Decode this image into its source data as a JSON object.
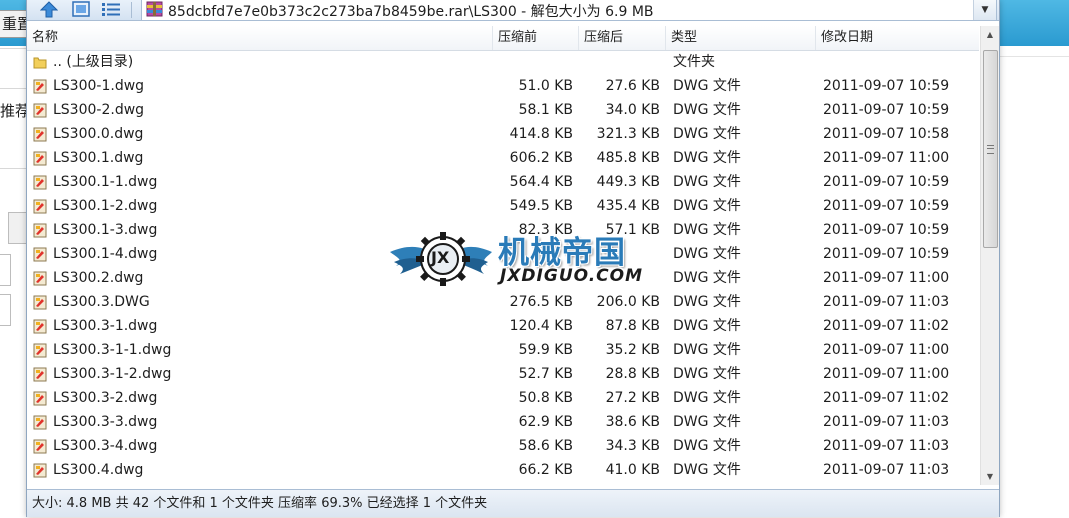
{
  "background_page": {
    "reset_button_label": "重置",
    "recommend_label": "推荐"
  },
  "toolbar": {
    "icons": [
      "up-arrow-icon",
      "view-mode-icon",
      "list-view-icon",
      "rar-archive-icon"
    ],
    "address_path": "85dcbfd7e7e0b373c2c273ba7b8459be.rar\\LS300 - 解包大小为 6.9 MB"
  },
  "columns": {
    "name": "名称",
    "packed": "压缩前",
    "size": "压缩后",
    "type": "类型",
    "modified": "修改日期"
  },
  "files": [
    {
      "name": ".. (上级目录)",
      "packed": "",
      "size": "",
      "type": "文件夹",
      "modified": "",
      "icon": "folder-icon"
    },
    {
      "name": "LS300-1.dwg",
      "packed": "51.0 KB",
      "size": "27.6 KB",
      "type": "DWG 文件",
      "modified": "2011-09-07 10:59",
      "icon": "dwg-file-icon"
    },
    {
      "name": "LS300-2.dwg",
      "packed": "58.1 KB",
      "size": "34.0 KB",
      "type": "DWG 文件",
      "modified": "2011-09-07 10:59",
      "icon": "dwg-file-icon"
    },
    {
      "name": "LS300.0.dwg",
      "packed": "414.8 KB",
      "size": "321.3 KB",
      "type": "DWG 文件",
      "modified": "2011-09-07 10:58",
      "icon": "dwg-file-icon"
    },
    {
      "name": "LS300.1.dwg",
      "packed": "606.2 KB",
      "size": "485.8 KB",
      "type": "DWG 文件",
      "modified": "2011-09-07 11:00",
      "icon": "dwg-file-icon"
    },
    {
      "name": "LS300.1-1.dwg",
      "packed": "564.4 KB",
      "size": "449.3 KB",
      "type": "DWG 文件",
      "modified": "2011-09-07 10:59",
      "icon": "dwg-file-icon"
    },
    {
      "name": "LS300.1-2.dwg",
      "packed": "549.5 KB",
      "size": "435.4 KB",
      "type": "DWG 文件",
      "modified": "2011-09-07 10:59",
      "icon": "dwg-file-icon"
    },
    {
      "name": "LS300.1-3.dwg",
      "packed": "82.3 KB",
      "size": "57.1 KB",
      "type": "DWG 文件",
      "modified": "2011-09-07 10:59",
      "icon": "dwg-file-icon"
    },
    {
      "name": "LS300.1-4.dwg",
      "packed": "",
      "size": "",
      "type": "DWG 文件",
      "modified": "2011-09-07 10:59",
      "icon": "dwg-file-icon"
    },
    {
      "name": "LS300.2.dwg",
      "packed": "",
      "size": "",
      "type": "DWG 文件",
      "modified": "2011-09-07 11:00",
      "icon": "dwg-file-icon"
    },
    {
      "name": "LS300.3.DWG",
      "packed": "276.5 KB",
      "size": "206.0 KB",
      "type": "DWG 文件",
      "modified": "2011-09-07 11:03",
      "icon": "dwg-file-icon"
    },
    {
      "name": "LS300.3-1.dwg",
      "packed": "120.4 KB",
      "size": "87.8 KB",
      "type": "DWG 文件",
      "modified": "2011-09-07 11:02",
      "icon": "dwg-file-icon"
    },
    {
      "name": "LS300.3-1-1.dwg",
      "packed": "59.9 KB",
      "size": "35.2 KB",
      "type": "DWG 文件",
      "modified": "2011-09-07 11:00",
      "icon": "dwg-file-icon"
    },
    {
      "name": "LS300.3-1-2.dwg",
      "packed": "52.7 KB",
      "size": "28.8 KB",
      "type": "DWG 文件",
      "modified": "2011-09-07 11:00",
      "icon": "dwg-file-icon"
    },
    {
      "name": "LS300.3-2.dwg",
      "packed": "50.8 KB",
      "size": "27.2 KB",
      "type": "DWG 文件",
      "modified": "2011-09-07 11:02",
      "icon": "dwg-file-icon"
    },
    {
      "name": "LS300.3-3.dwg",
      "packed": "62.9 KB",
      "size": "38.6 KB",
      "type": "DWG 文件",
      "modified": "2011-09-07 11:03",
      "icon": "dwg-file-icon"
    },
    {
      "name": "LS300.3-4.dwg",
      "packed": "58.6 KB",
      "size": "34.3 KB",
      "type": "DWG 文件",
      "modified": "2011-09-07 11:03",
      "icon": "dwg-file-icon"
    },
    {
      "name": "LS300.4.dwg",
      "packed": "66.2 KB",
      "size": "41.0 KB",
      "type": "DWG 文件",
      "modified": "2011-09-07 11:03",
      "icon": "dwg-file-icon"
    }
  ],
  "status_text": "大小: 4.8 MB 共 42 个文件和 1 个文件夹 压缩率 69.3% 已经选择 1 个文件夹",
  "watermark": {
    "logo_text": "JX",
    "title_cn": "机械帝国",
    "title_en": "JXDIGUO.COM"
  },
  "colors": {
    "accent": "#2a9ad0",
    "watermark_blue": "#2a7bb8",
    "toolbar_bg": "#d4e2f2"
  }
}
